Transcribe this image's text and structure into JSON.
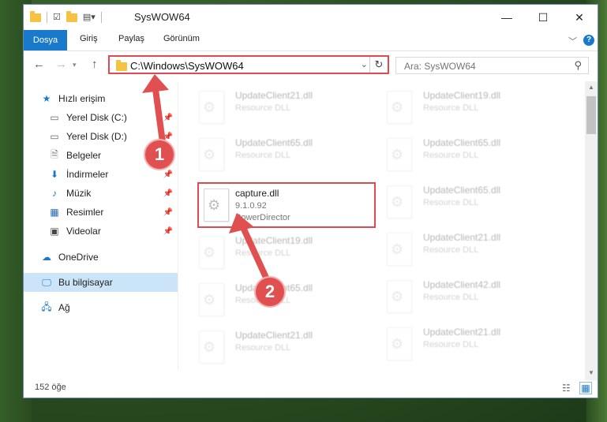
{
  "window": {
    "title": "SysWOW64",
    "minimize": "—",
    "maximize": "☐",
    "close": "✕"
  },
  "ribbon": {
    "tabs": [
      "Dosya",
      "Giriş",
      "Paylaş",
      "Görünüm"
    ],
    "help": "?"
  },
  "nav": {
    "address": "C:\\Windows\\SysWOW64",
    "search_placeholder": "Ara: SysWOW64"
  },
  "sidebar": {
    "items": [
      {
        "label": "Hızlı erişim",
        "icon": "star-icon"
      },
      {
        "label": "Yerel Disk (C:)",
        "icon": "drive-icon"
      },
      {
        "label": "Yerel Disk (D:)",
        "icon": "drive-icon"
      },
      {
        "label": "Belgeler",
        "icon": "documents-icon"
      },
      {
        "label": "İndirmeler",
        "icon": "download-icon"
      },
      {
        "label": "Müzik",
        "icon": "music-icon"
      },
      {
        "label": "Resimler",
        "icon": "pictures-icon"
      },
      {
        "label": "Videolar",
        "icon": "video-icon"
      },
      {
        "label": "OneDrive",
        "icon": "cloud-icon"
      },
      {
        "label": "Bu bilgisayar",
        "icon": "computer-icon"
      },
      {
        "label": "Ağ",
        "icon": "network-icon"
      }
    ]
  },
  "files": {
    "left": [
      {
        "name": "UpdateClient21.dll",
        "type": "Resource DLL"
      },
      {
        "name": "UpdateClient65.dll",
        "type": "Resource DLL"
      },
      {
        "name": "capture.dll",
        "version": "9.1.0.92",
        "company": "PowerDirector"
      },
      {
        "name": "UpdateClient19.dll",
        "type": "Resource DLL"
      },
      {
        "name": "UpdateClient65.dll",
        "type": "Resource DLL"
      },
      {
        "name": "UpdateClient21.dll",
        "type": "Resource DLL"
      }
    ],
    "right": [
      {
        "name": "UpdateClient19.dll",
        "type": "Resource DLL"
      },
      {
        "name": "UpdateClient65.dll",
        "type": "Resource DLL"
      },
      {
        "name": "UpdateClient65.dll",
        "type": "Resource DLL"
      },
      {
        "name": "UpdateClient21.dll",
        "type": "Resource DLL"
      },
      {
        "name": "UpdateClient42.dll",
        "type": "Resource DLL"
      },
      {
        "name": "UpdateClient21.dll",
        "type": "Resource DLL"
      }
    ]
  },
  "status": {
    "count": "152 öğe"
  },
  "annotations": {
    "badge1": "1",
    "badge2": "2"
  },
  "colors": {
    "accent": "#1979ca",
    "highlight": "#e0494f"
  }
}
